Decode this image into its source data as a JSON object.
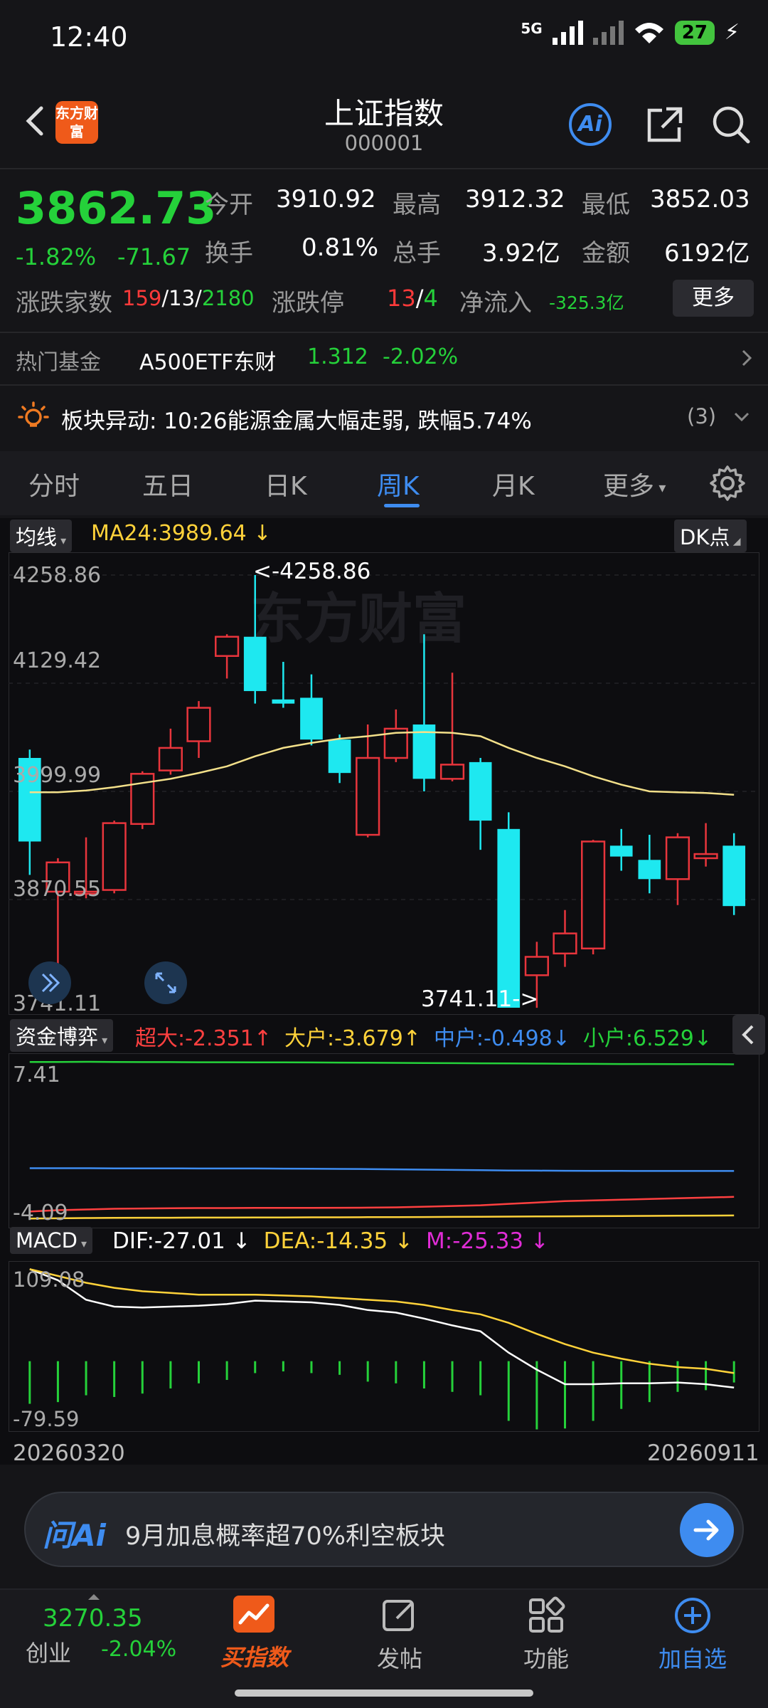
{
  "status": {
    "time": "12:40",
    "network": "5G",
    "battery": "27"
  },
  "header": {
    "title": "上证指数",
    "code": "000001",
    "logo": "东方财富",
    "ai": "Ai"
  },
  "quote": {
    "price": "3862.73",
    "change_pct": "-1.82%",
    "change_abs": "-71.67",
    "open_label": "今开",
    "open": "3910.92",
    "high_label": "最高",
    "high": "3912.32",
    "low_label": "最低",
    "low": "3852.03",
    "turnover_label": "换手",
    "turnover": "0.81%",
    "volume_label": "总手",
    "volume": "3.92亿",
    "amount_label": "金额",
    "amount": "6192亿",
    "breadth_label": "涨跌家数",
    "breadth_up": "159",
    "breadth_flat": "13",
    "breadth_down": "2180",
    "limit_label": "涨跌停",
    "limit_up": "13",
    "limit_down": "4",
    "inflow_label": "净流入",
    "inflow": "-325.3亿",
    "more": "更多"
  },
  "fund": {
    "label": "热门基金",
    "name": "A500ETF东财",
    "price": "1.312",
    "change": "-2.02%"
  },
  "alert": {
    "text": "板块异动: 10:26能源金属大幅走弱, 跌幅5.74%",
    "count": "(3)"
  },
  "tabs": [
    "分时",
    "五日",
    "日K",
    "周K",
    "月K",
    "更多"
  ],
  "main_chart": {
    "indicator": "均线",
    "ma_label": "MA24:3989.64",
    "ma_arrow": "↓",
    "dk": "DK点",
    "y_labels": [
      "4258.86",
      "4129.42",
      "3999.99",
      "3870.55",
      "3741.11"
    ],
    "max_note": "<-4258.86",
    "min_note": "3741.11->",
    "watermark": "东方财富"
  },
  "flow_chart": {
    "indicator": "资金博弈",
    "items": [
      {
        "label": "超大:-2.351",
        "arrow": "↑",
        "color": "#ff4040"
      },
      {
        "label": "大户:-3.679",
        "arrow": "↑",
        "color": "#ffd23a"
      },
      {
        "label": "中户:-0.498",
        "arrow": "↓",
        "color": "#3e8cf0"
      },
      {
        "label": "小户:6.529",
        "arrow": "↓",
        "color": "#25d13a"
      }
    ],
    "y_labels": [
      "7.41",
      "-4.09"
    ]
  },
  "macd_chart": {
    "indicator": "MACD",
    "dif": "DIF:-27.01",
    "dif_arrow": "↓",
    "dea": "DEA:-14.35",
    "dea_arrow": "↓",
    "m": "M:-25.33",
    "m_arrow": "↓",
    "y_labels": [
      "109.08",
      "-79.59"
    ]
  },
  "date_range": {
    "start": "20260320",
    "end": "20260911"
  },
  "chart_data": {
    "type": "candlestick",
    "ylim": [
      3741.11,
      4258.86
    ],
    "candles": [
      {
        "o": 4040,
        "c": 3940,
        "h": 4050,
        "l": 3900
      },
      {
        "o": 3880,
        "c": 3915,
        "h": 3920,
        "l": 3790
      },
      {
        "o": 3880,
        "c": 3880,
        "h": 3945,
        "l": 3872
      },
      {
        "o": 3882,
        "c": 3962,
        "h": 3965,
        "l": 3878
      },
      {
        "o": 3961,
        "c": 4021,
        "h": 4024,
        "l": 3955
      },
      {
        "o": 4025,
        "c": 4052,
        "h": 4075,
        "l": 4020
      },
      {
        "o": 4060,
        "c": 4100,
        "h": 4108,
        "l": 4040
      },
      {
        "o": 4162,
        "c": 4185,
        "h": 4188,
        "l": 4135
      },
      {
        "o": 4185,
        "c": 4120,
        "h": 4258.86,
        "l": 4105
      },
      {
        "o": 4110,
        "c": 4105,
        "h": 4155,
        "l": 4100
      },
      {
        "o": 4112,
        "c": 4062,
        "h": 4140,
        "l": 4055
      },
      {
        "o": 4062,
        "c": 4022,
        "h": 4068,
        "l": 4010
      },
      {
        "o": 3948,
        "c": 4040,
        "h": 4080,
        "l": 3945
      },
      {
        "o": 4040,
        "c": 4075,
        "h": 4098,
        "l": 4035
      },
      {
        "o": 4080,
        "c": 4015,
        "h": 4188,
        "l": 4000
      },
      {
        "o": 4015,
        "c": 4032,
        "h": 4142,
        "l": 4012
      },
      {
        "o": 4035,
        "c": 3965,
        "h": 4040,
        "l": 3930
      },
      {
        "o": 3955,
        "c": 3741.11,
        "h": 3975,
        "l": 3741.11
      },
      {
        "o": 3780,
        "c": 3802,
        "h": 3820,
        "l": 3741
      },
      {
        "o": 3806,
        "c": 3830,
        "h": 3858,
        "l": 3790
      },
      {
        "o": 3812,
        "c": 3940,
        "h": 3942,
        "l": 3805
      },
      {
        "o": 3935,
        "c": 3922,
        "h": 3955,
        "l": 3905
      },
      {
        "o": 3918,
        "c": 3895,
        "h": 3948,
        "l": 3878
      },
      {
        "o": 3895,
        "c": 3945,
        "h": 3950,
        "l": 3864
      },
      {
        "o": 3920,
        "c": 3925,
        "h": 3962,
        "l": 3910
      },
      {
        "o": 3935,
        "c": 3862.73,
        "h": 3950,
        "l": 3852
      }
    ],
    "ma24": [
      3999,
      3999,
      4001,
      4005,
      4010,
      4015,
      4022,
      4030,
      4042,
      4052,
      4058,
      4063,
      4066,
      4070,
      4071,
      4070,
      4066,
      4052,
      4040,
      4030,
      4018,
      4008,
      4000,
      3999,
      3998,
      3996
    ],
    "flow": {
      "ylim": [
        -4.09,
        7.41
      ],
      "small": [
        7.3,
        7.3,
        7.31,
        7.3,
        7.29,
        7.29,
        7.28,
        7.28,
        7.27,
        7.27,
        7.26,
        7.25,
        7.24,
        7.23,
        7.22,
        7.21,
        7.2,
        7.19,
        7.18,
        7.17,
        7.16,
        7.15,
        7.15,
        7.14,
        7.14,
        7.13
      ],
      "medium": [
        -0.3,
        -0.3,
        -0.3,
        -0.31,
        -0.31,
        -0.31,
        -0.32,
        -0.32,
        -0.32,
        -0.33,
        -0.34,
        -0.35,
        -0.36,
        -0.38,
        -0.4,
        -0.42,
        -0.44,
        -0.46,
        -0.47,
        -0.48,
        -0.49,
        -0.49,
        -0.5,
        -0.5,
        -0.5,
        -0.5
      ],
      "super": [
        -3.4,
        -3.3,
        -3.25,
        -3.2,
        -3.18,
        -3.16,
        -3.15,
        -3.15,
        -3.14,
        -3.14,
        -3.14,
        -3.13,
        -3.12,
        -3.1,
        -3.05,
        -3.0,
        -2.95,
        -2.85,
        -2.75,
        -2.65,
        -2.6,
        -2.55,
        -2.5,
        -2.45,
        -2.4,
        -2.35
      ],
      "large": [
        -3.9,
        -3.88,
        -3.86,
        -3.85,
        -3.84,
        -3.84,
        -3.83,
        -3.83,
        -3.82,
        -3.82,
        -3.81,
        -3.81,
        -3.8,
        -3.8,
        -3.79,
        -3.78,
        -3.77,
        -3.76,
        -3.75,
        -3.74,
        -3.73,
        -3.72,
        -3.71,
        -3.7,
        -3.69,
        -3.68
      ]
    },
    "macd": {
      "ylim": [
        -79.59,
        109.08
      ],
      "dif": [
        108,
        95,
        72,
        64,
        63,
        64,
        65,
        67,
        71,
        70,
        69,
        66,
        60,
        57,
        50,
        42,
        35,
        10,
        -10,
        -27,
        -27,
        -26,
        -26,
        -25,
        -27,
        -31
      ],
      "dea": [
        108,
        100,
        92,
        86,
        82,
        80,
        78,
        78,
        78,
        77,
        76,
        74,
        72,
        70,
        66,
        60,
        55,
        45,
        32,
        20,
        10,
        3,
        -3,
        -7,
        -9,
        -14
      ],
      "m": [
        -50,
        -48,
        -40,
        -42,
        -38,
        -32,
        -26,
        -22,
        -14,
        -12,
        -14,
        -16,
        -24,
        -26,
        -32,
        -36,
        -40,
        -70,
        -80,
        -79,
        -70,
        -56,
        -48,
        -36,
        -34,
        -25
      ]
    }
  }
}
